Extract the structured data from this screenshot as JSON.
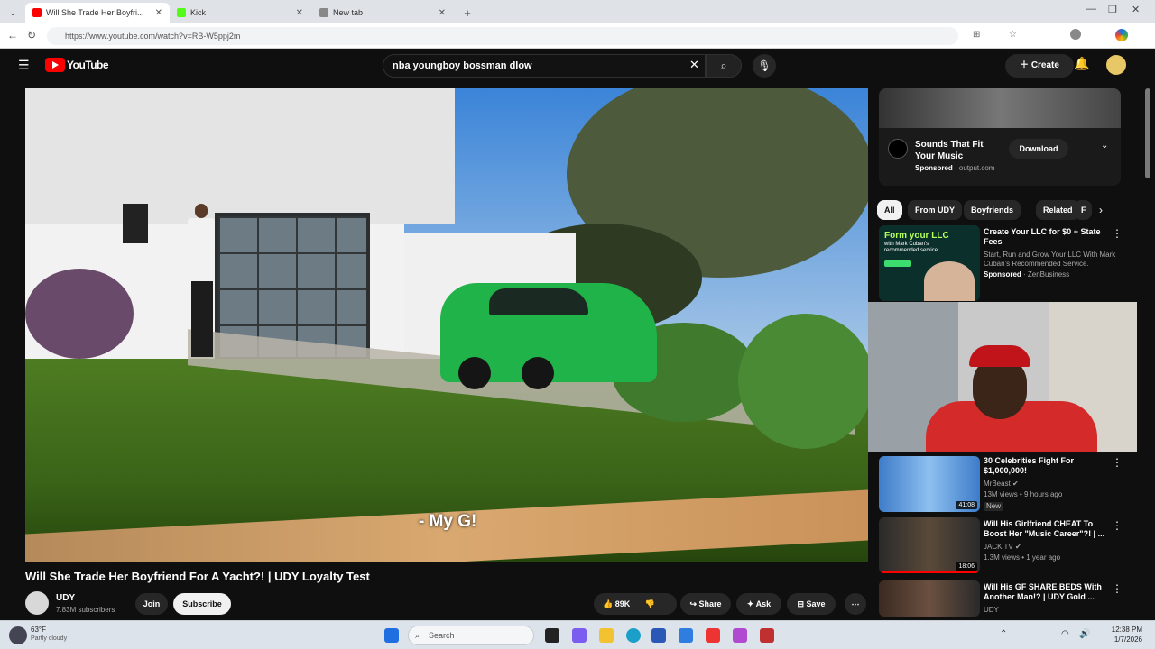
{
  "browser": {
    "tabs": [
      {
        "title": "Will She Trade Her Boyfri...",
        "active": true,
        "favicon_color": "#ff0000"
      },
      {
        "title": "Kick",
        "active": false,
        "favicon_color": "#53fc18"
      },
      {
        "title": "New tab",
        "active": false,
        "favicon_color": "#888888"
      }
    ],
    "url": "https://www.youtube.com/watch?v=RB-W5ppj2m"
  },
  "youtube": {
    "logo_text": "YouTube",
    "search": {
      "query": "nba youngboy bossman dlow"
    },
    "create_label": "Create",
    "video": {
      "subtitle": "- My G!",
      "title": "Will She Trade Her Boyfriend For A Yacht?! | UDY Loyalty Test",
      "channel": "UDY",
      "subscribers": "7.83M subscribers",
      "join_label": "Join",
      "subscribe_label": "Subscribe",
      "likes": "89K",
      "share_label": "Share",
      "ask_label": "Ask",
      "save_label": "Save"
    },
    "ad": {
      "title": "Sounds That Fit Your Music",
      "sponsor": "Sponsored",
      "domain": "output.com",
      "download_label": "Download"
    },
    "chips": [
      "All",
      "From UDY",
      "Boyfriends",
      "Related",
      "F"
    ],
    "sponsored_card": {
      "thumb_headline": "Form your LLC",
      "thumb_sub": "with Mark Cuban's recommended service",
      "title": "Create Your LLC for $0 + State Fees",
      "description": "Start, Run and Grow Your LLC With Mark Cuban's Recommended Service.",
      "sponsor": "Sponsored",
      "domain": "ZenBusiness"
    },
    "recommendations": [
      {
        "title": "30 Celebrities Fight For $1,000,000!",
        "channel": "MrBeast",
        "meta": "13M views • 9 hours ago",
        "badge": "New",
        "duration": "41:08"
      },
      {
        "title": "Will His Girlfriend CHEAT To Boost Her \"Music Career\"?! | ...",
        "channel": "JACK TV",
        "meta": "1.3M views • 1 year ago",
        "badge": "",
        "duration": "18:06"
      },
      {
        "title": "Will His GF SHARE BEDS With Another Man!? | UDY Gold ...",
        "channel": "UDY",
        "meta": "",
        "badge": "",
        "duration": ""
      }
    ]
  },
  "taskbar": {
    "search_placeholder": "Search",
    "weather_temp": "63°F",
    "weather_desc": "Partly cloudy",
    "time": "12:38 PM",
    "date": "1/7/2026"
  }
}
